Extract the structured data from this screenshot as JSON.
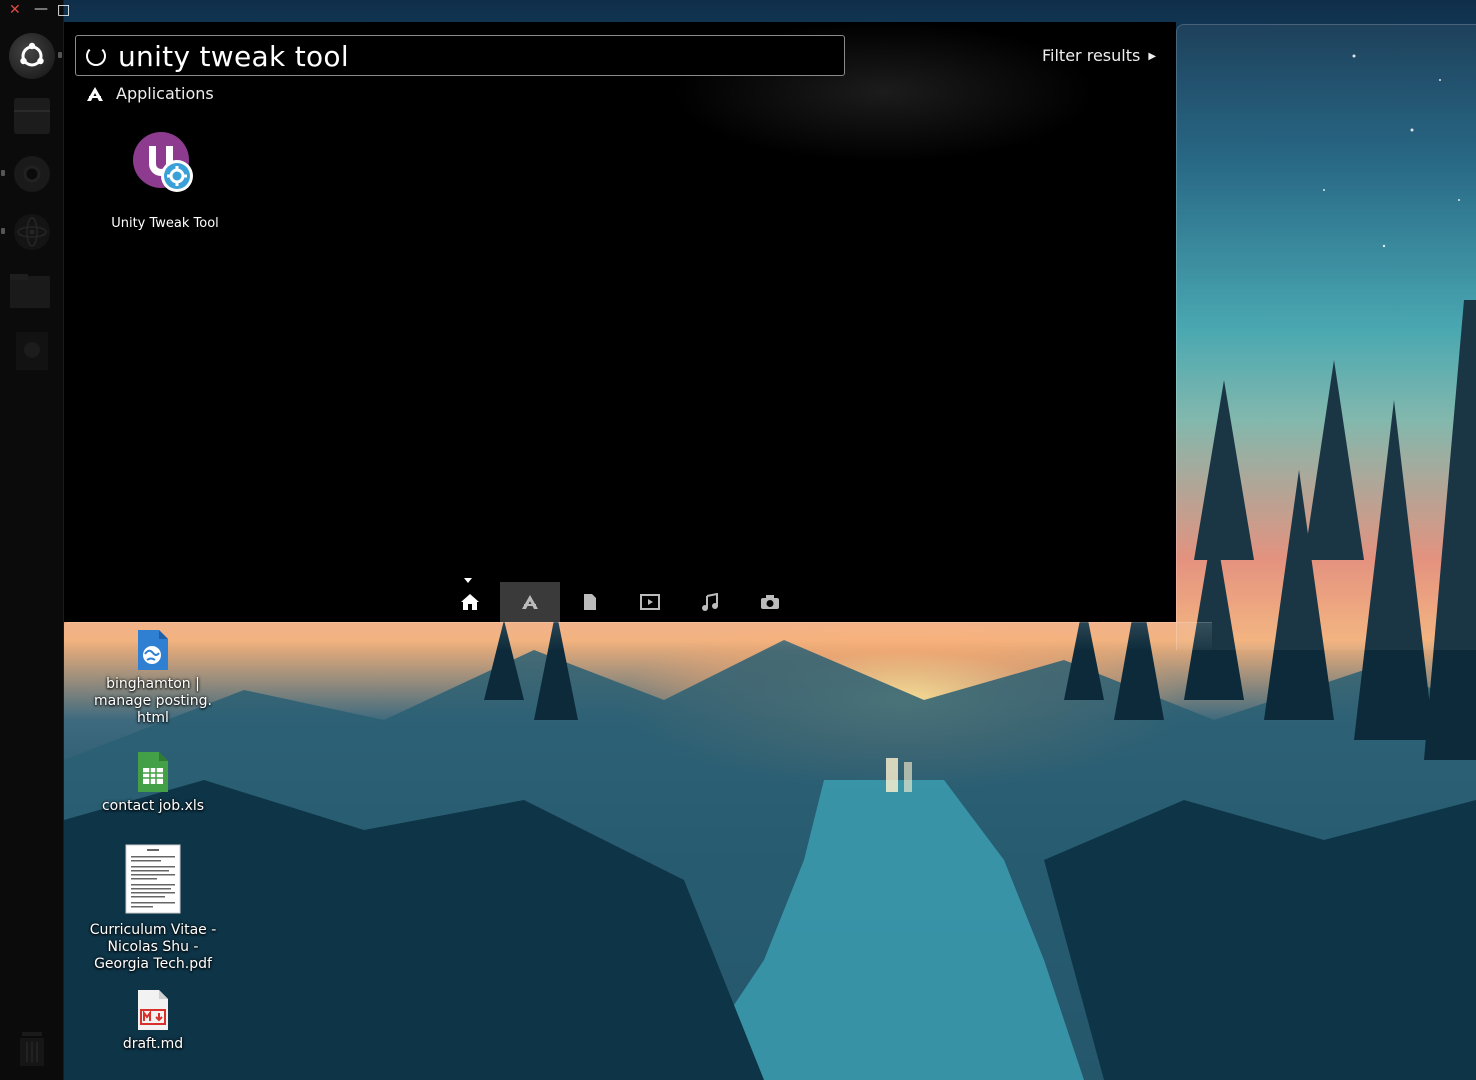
{
  "window_controls": {
    "close": "✕",
    "minimize": "—",
    "maximize": "□"
  },
  "search": {
    "value": "unity tweak tool",
    "placeholder": ""
  },
  "filter": {
    "label": "Filter results"
  },
  "category": {
    "label": "Applications",
    "icon": "applications-icon"
  },
  "results": [
    {
      "name": "Unity Tweak Tool",
      "icon": "unity-tweak-tool-icon"
    }
  ],
  "lenses": [
    {
      "name": "home",
      "icon": "home-icon",
      "active": false
    },
    {
      "name": "applications",
      "icon": "applications-icon",
      "active": true
    },
    {
      "name": "files",
      "icon": "file-icon",
      "active": false
    },
    {
      "name": "video",
      "icon": "video-icon",
      "active": false
    },
    {
      "name": "music",
      "icon": "music-icon",
      "active": false
    },
    {
      "name": "photos",
      "icon": "camera-icon",
      "active": false
    }
  ],
  "launcher": [
    "ubuntu-dash-icon",
    "files-icon",
    "chrome-icon",
    "atom-icon",
    "folder-icon",
    "disk-icon",
    "trash-icon"
  ],
  "desktop_icons": [
    {
      "label": "binghamton | manage posting. html",
      "icon": "html-file-icon"
    },
    {
      "label": "contact job.xls",
      "icon": "spreadsheet-icon"
    },
    {
      "label": "Curriculum Vitae - Nicolas Shu - Georgia Tech.pdf",
      "icon": "pdf-document-icon"
    },
    {
      "label": "draft.md",
      "icon": "markdown-file-icon"
    }
  ],
  "colors": {
    "accent_purple": "#8c3b8e",
    "gear_blue": "#3aa0d8",
    "sheet_green": "#43a047",
    "close_red": "#e04a3f"
  }
}
